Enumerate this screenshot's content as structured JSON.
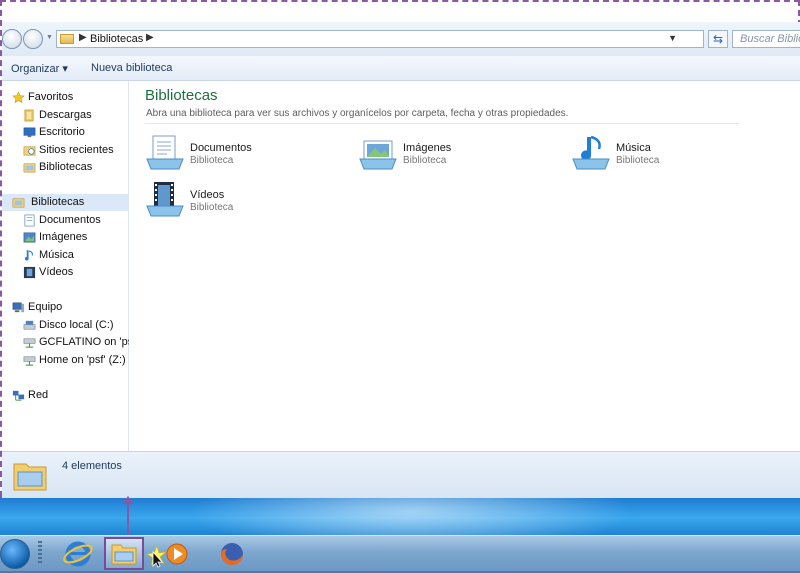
{
  "address": {
    "path_label": "Bibliotecas",
    "search_placeholder": "Buscar Bibliotecas"
  },
  "toolbar": {
    "organize_label": "Organizar ▾",
    "new_library_label": "Nueva biblioteca"
  },
  "nav": {
    "favorites": {
      "label": "Favoritos",
      "items": [
        "Descargas",
        "Escritorio",
        "Sitios recientes",
        "Bibliotecas"
      ]
    },
    "libraries": {
      "label": "Bibliotecas",
      "items": [
        "Documentos",
        "Imágenes",
        "Música",
        "Vídeos"
      ]
    },
    "computer": {
      "label": "Equipo",
      "items": [
        "Disco local (C:)",
        "GCFLATINO on 'psf'",
        "Home on 'psf' (Z:)"
      ]
    },
    "network": {
      "label": "Red"
    }
  },
  "content": {
    "title": "Bibliotecas",
    "description": "Abra una biblioteca para ver sus archivos y organícelos por carpeta, fecha y otras propiedades.",
    "libraries": [
      {
        "name": "Documentos",
        "type": "Biblioteca",
        "icon": "documents-library-icon"
      },
      {
        "name": "Imágenes",
        "type": "Biblioteca",
        "icon": "pictures-library-icon"
      },
      {
        "name": "Música",
        "type": "Biblioteca",
        "icon": "music-library-icon"
      },
      {
        "name": "Vídeos",
        "type": "Biblioteca",
        "icon": "videos-library-icon"
      }
    ]
  },
  "status": {
    "count_text": "4 elementos"
  },
  "taskbar": {
    "apps": [
      "internet-explorer-icon",
      "windows-explorer-icon",
      "media-player-icon",
      "firefox-icon"
    ]
  },
  "colors": {
    "title_green": "#1e6f3f",
    "annotation_purple": "#8a59a6",
    "taskbar_blue": "#7ea7cf"
  }
}
